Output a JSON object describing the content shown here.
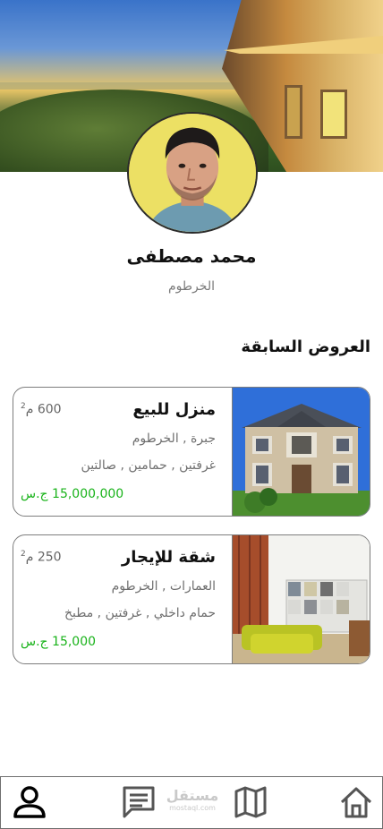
{
  "profile": {
    "name": "محمد مصطفى",
    "location": "الخرطوم"
  },
  "offers_section": {
    "title": "العروض السابقة"
  },
  "offers": [
    {
      "title": "منزل للبيع",
      "area": "600 م",
      "area_sup": "2",
      "location": "جبرة , الخرطوم",
      "rooms": "غرفتين , حمامين , صالتين",
      "price": "15,000,000 ج.س"
    },
    {
      "title": "شقة للإيجار",
      "area": "250 م",
      "area_sup": "2",
      "location": "العمارات , الخرطوم",
      "rooms": "حمام داخلي , غرفتين , مطبخ",
      "price": "15,000 ج.س"
    }
  ],
  "bottom_nav": {
    "items": [
      {
        "icon": "profile-icon",
        "active": true
      },
      {
        "icon": "chat-icon",
        "active": false
      },
      {
        "icon": "map-icon",
        "active": false
      },
      {
        "icon": "home-icon",
        "active": false
      }
    ],
    "watermark_main": "مستقل",
    "watermark_sub": "mostaql.com"
  },
  "colors": {
    "price": "#19b31a",
    "nav_inactive": "#555555",
    "nav_active": "#000000"
  }
}
